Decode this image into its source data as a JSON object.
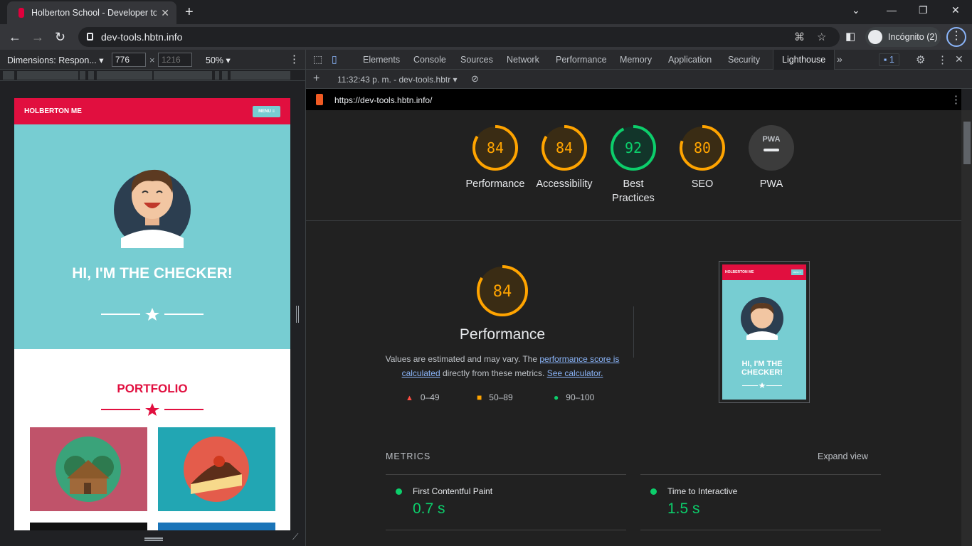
{
  "browser": {
    "tab_title": "Holberton School - Developer to",
    "url": "dev-tools.hbtn.info",
    "profile": "Incógnito (2)"
  },
  "device_toolbar": {
    "dimensions": "Dimensions: Respon...",
    "width": "776",
    "height_placeholder": "1216",
    "zoom": "50%"
  },
  "site": {
    "brand": "HOLBERTON ME",
    "menu": "MENU ≡",
    "hero_title": "HI, I'M THE CHECKER!",
    "portfolio_title": "PORTFOLIO"
  },
  "devtools": {
    "tabs": [
      "Elements",
      "Console",
      "Sources",
      "Network",
      "Performance",
      "Memory",
      "Application",
      "Security",
      "Lighthouse"
    ],
    "active_tab": "Lighthouse",
    "issues_count": "1",
    "report_time": "11:32:43 p. m. - dev-tools.hbtr",
    "report_url": "https://dev-tools.hbtn.info/"
  },
  "lighthouse": {
    "gauges": [
      {
        "score": "84",
        "label": "Performance",
        "status": "average"
      },
      {
        "score": "84",
        "label": "Accessibility",
        "status": "average"
      },
      {
        "score": "92",
        "label": "Best Practices",
        "status": "pass"
      },
      {
        "score": "80",
        "label": "SEO",
        "status": "average"
      },
      {
        "score": "PWA",
        "label": "PWA",
        "status": "na"
      }
    ],
    "perf_score": "84",
    "perf_title": "Performance",
    "desc_1": "Values are estimated and may vary. The",
    "desc_link_1": "performance score is calculated",
    "desc_2": "directly from these metrics.",
    "desc_link_2": "See calculator.",
    "legend": [
      "0–49",
      "50–89",
      "90–100"
    ],
    "screenshot_brand": "HOLBERTON ME",
    "screenshot_menu": "MENU ≡",
    "screenshot_title": "HI, I'M THE CHECKER!",
    "metrics_title": "METRICS",
    "expand": "Expand view",
    "metrics": [
      {
        "name": "First Contentful Paint",
        "value": "0.7 s"
      },
      {
        "name": "Time to Interactive",
        "value": "1.5 s"
      }
    ]
  },
  "colors": {
    "average": "#ffa400",
    "pass": "#0cce6b",
    "fail": "#ff4e42",
    "brand": "#e10f3f",
    "hero": "#77cdd2"
  }
}
